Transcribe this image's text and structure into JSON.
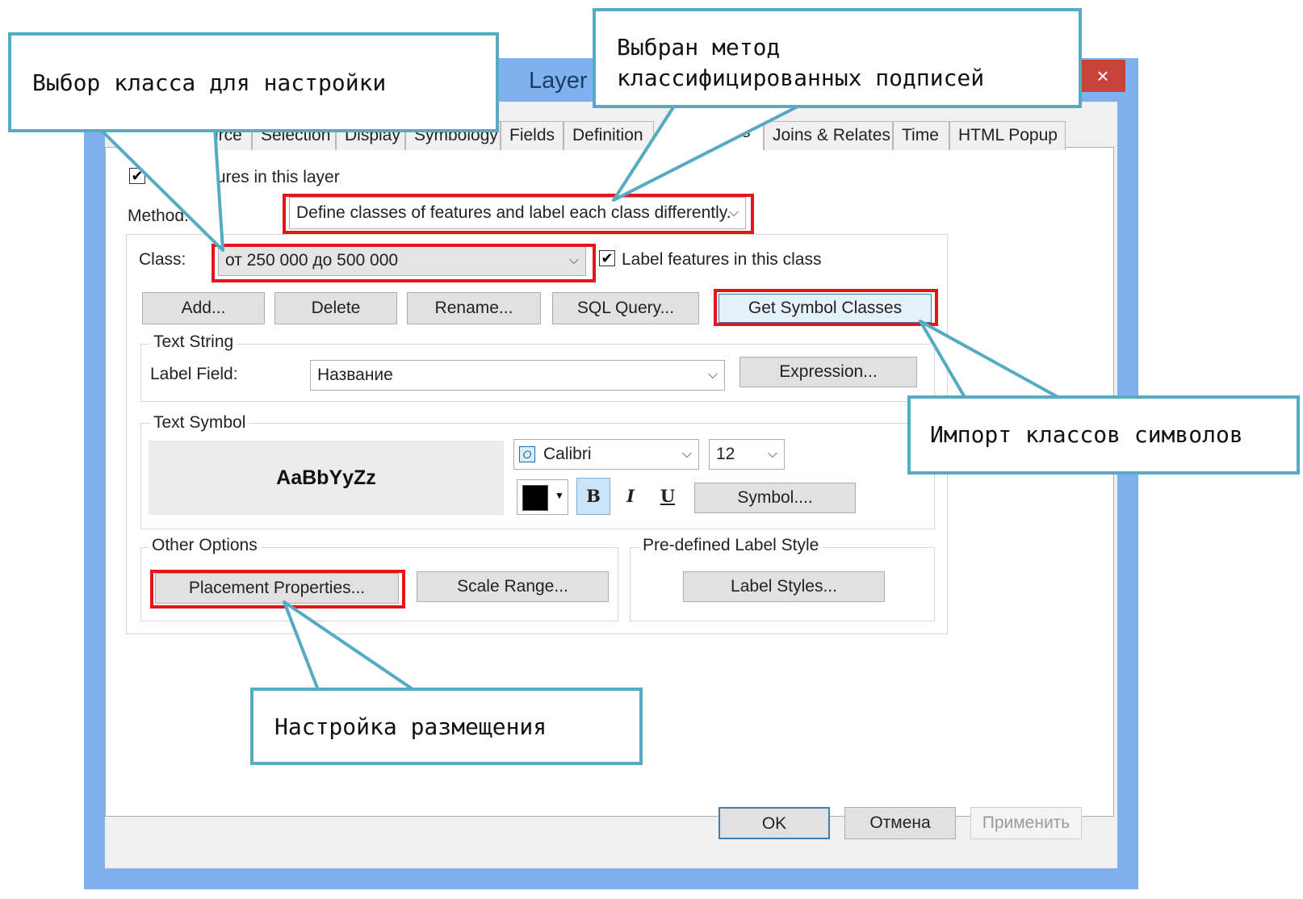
{
  "window": {
    "title": "Layer Properties",
    "close_label": "×"
  },
  "tabs": [
    "urce",
    "Selection",
    "Display",
    "Symbology",
    "Fields",
    "Definition",
    "bels",
    "Joins & Relates",
    "Time",
    "HTML Popup"
  ],
  "layer_checkbox_label": "tures in this layer",
  "method": {
    "label": "Method:",
    "value": "Define classes of features and label each class differently."
  },
  "class": {
    "label": "Class:",
    "value": "от 250 000 до 500 000",
    "checkbox_label": "Label features in this class",
    "checked": true
  },
  "buttons": {
    "add": "Add...",
    "delete": "Delete",
    "rename": "Rename...",
    "sql": "SQL Query...",
    "get_symbol_classes": "Get Symbol Classes"
  },
  "text_string": {
    "group": "Text String",
    "field_label": "Label Field:",
    "field_value": "Название",
    "expression": "Expression..."
  },
  "text_symbol": {
    "group": "Text Symbol",
    "preview": "AaBbYyZz",
    "font": "Calibri",
    "size": "12",
    "bold": "B",
    "italic": "I",
    "underline": "U",
    "symbol_button": "Symbol....",
    "color": "#000000"
  },
  "other_options": {
    "group": "Other Options",
    "placement": "Placement Properties...",
    "scale": "Scale Range..."
  },
  "predefined": {
    "group": "Pre-defined Label Style",
    "styles": "Label Styles..."
  },
  "footer": {
    "ok": "OK",
    "cancel": "Отмена",
    "apply": "Применить"
  },
  "callouts": {
    "class_select": "Выбор класса для настройки",
    "method": "Выбран метод\nклассифицированных подписей",
    "import": "Импорт классов символов",
    "placement": "Настройка размещения"
  },
  "colors": {
    "callout_border": "#56abc3",
    "highlight": "#e8141b",
    "titlebar": "#7fb1ef"
  }
}
